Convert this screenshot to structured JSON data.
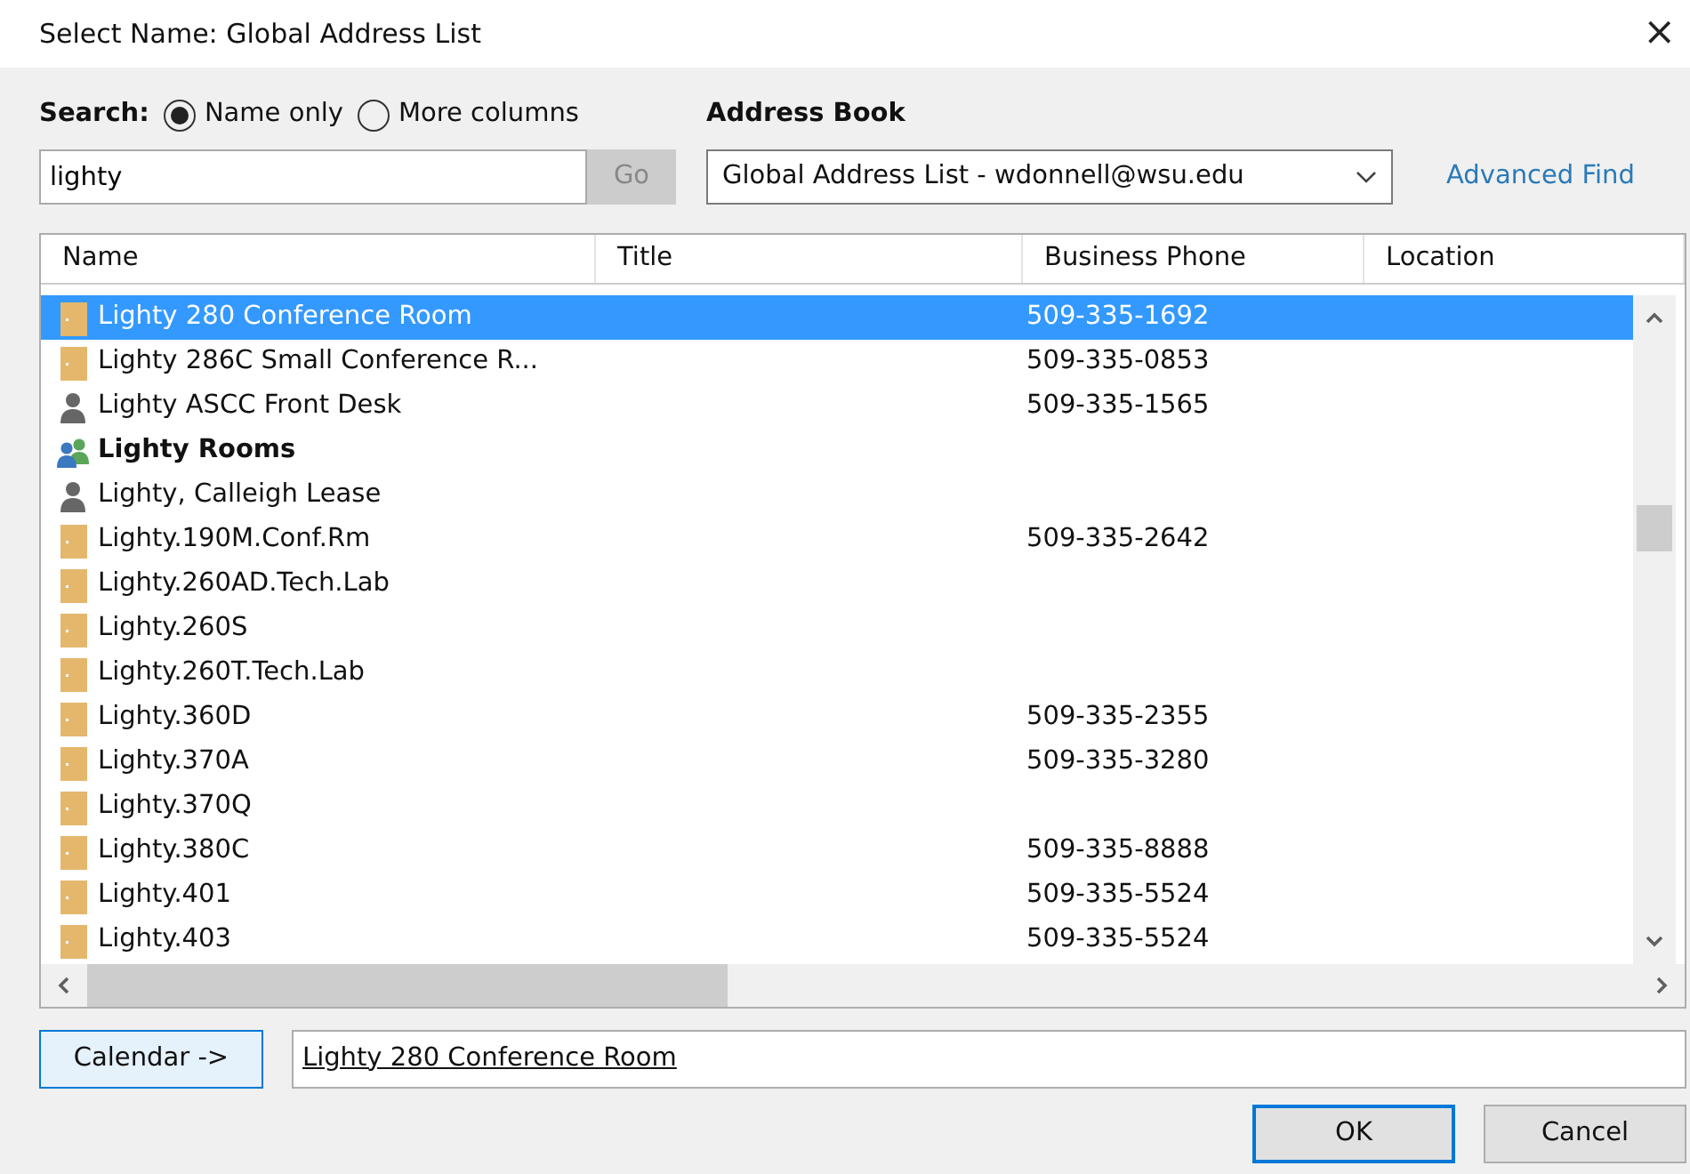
{
  "window": {
    "title": "Select Name: Global Address List",
    "close": "×"
  },
  "search": {
    "label": "Search:",
    "options": [
      {
        "label": "Name only",
        "selected": true
      },
      {
        "label": "More columns",
        "selected": false
      }
    ],
    "value": "lighty",
    "go_button": "Go",
    "go_disabled": true
  },
  "address_book": {
    "label": "Address Book",
    "value": "Global Address List - wdonnell@wsu.edu"
  },
  "advanced_find": "Advanced Find",
  "table": {
    "columns": [
      "Name",
      "Title",
      "Business Phone",
      "Location"
    ],
    "rows": [
      {
        "kind": "room",
        "name": "Lighty 280 Conference Room",
        "phone": "509-335-1692",
        "selected": true
      },
      {
        "kind": "room",
        "name": "Lighty 286C Small Conference R...",
        "phone": "509-335-0853",
        "selected": false
      },
      {
        "kind": "person",
        "name": "Lighty ASCC Front Desk",
        "phone": "509-335-1565",
        "selected": false
      },
      {
        "kind": "group",
        "name": "Lighty Rooms",
        "selected": false
      },
      {
        "kind": "person",
        "name": "Lighty, Calleigh Lease",
        "selected": false
      },
      {
        "kind": "room",
        "name": "Lighty.190M.Conf.Rm",
        "phone": "509-335-2642",
        "selected": false
      },
      {
        "kind": "room",
        "name": "Lighty.260AD.Tech.Lab",
        "selected": false
      },
      {
        "kind": "room",
        "name": "Lighty.260S",
        "selected": false
      },
      {
        "kind": "room",
        "name": "Lighty.260T.Tech.Lab",
        "selected": false
      },
      {
        "kind": "room",
        "name": "Lighty.360D",
        "phone": "509-335-2355",
        "selected": false
      },
      {
        "kind": "room",
        "name": "Lighty.370A",
        "phone": "509-335-3280",
        "selected": false
      },
      {
        "kind": "room",
        "name": "Lighty.370Q",
        "selected": false
      },
      {
        "kind": "room",
        "name": "Lighty.380C",
        "phone": "509-335-8888",
        "selected": false
      },
      {
        "kind": "room",
        "name": "Lighty.401",
        "phone": "509-335-5524",
        "selected": false
      },
      {
        "kind": "room",
        "name": "Lighty.403",
        "phone": "509-335-5524",
        "selected": false
      }
    ]
  },
  "calendar_button": "Calendar ->",
  "recipient_field": {
    "value": "Lighty 280 Conference Room"
  },
  "buttons": [
    {
      "label": "OK",
      "default": true
    },
    {
      "label": "Cancel",
      "default": false
    }
  ]
}
